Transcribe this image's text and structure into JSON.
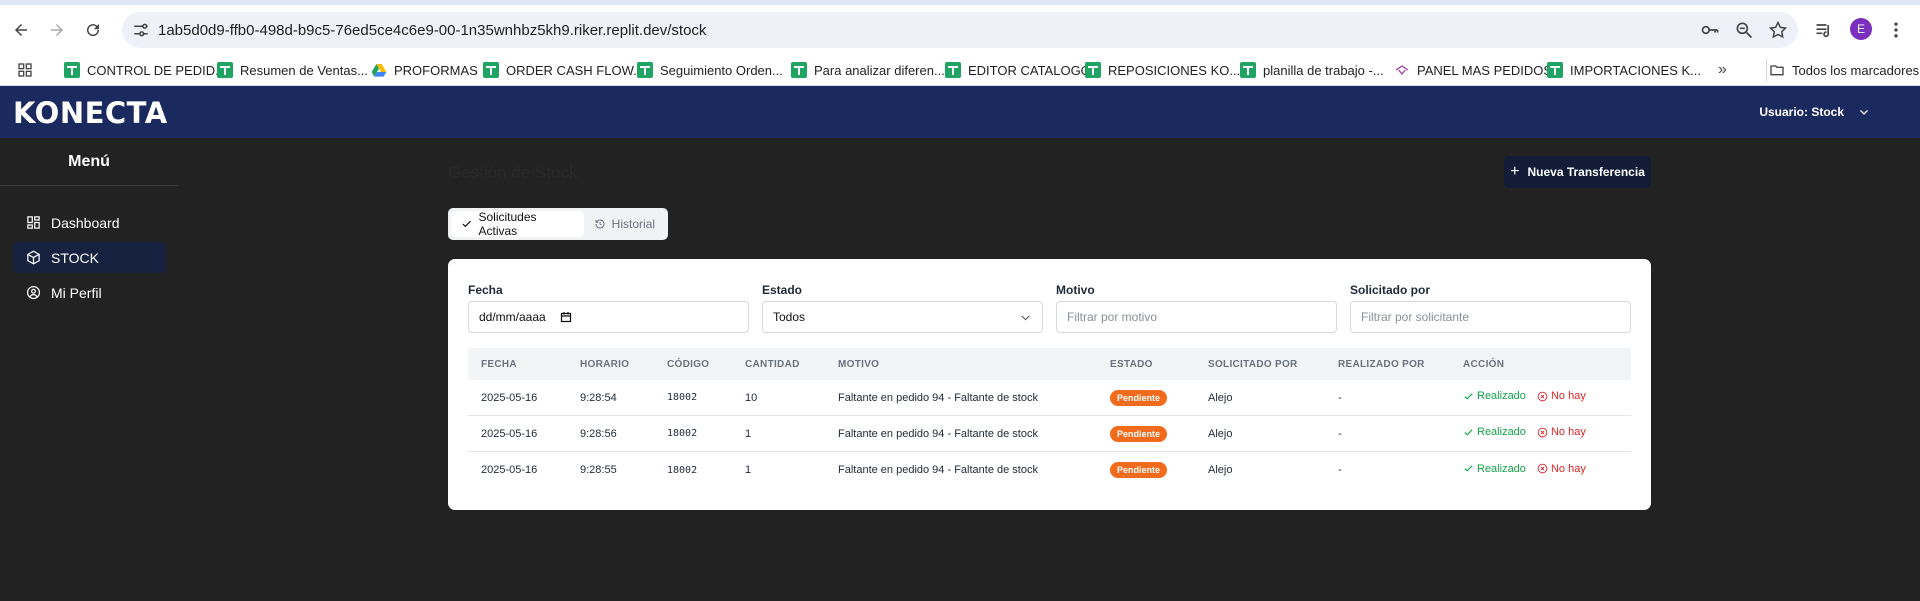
{
  "browser": {
    "url": "1ab5d0d9-ffb0-498d-b9c5-76ed5ce4c6e9-00-1n35wnhbz5kh9.riker.replit.dev/stock",
    "profile_initial": "E",
    "bookmarks": [
      {
        "label": "CONTROL DE PEDID...",
        "icon": "sheets-icon"
      },
      {
        "label": "Resumen de Ventas...",
        "icon": "sheets-icon"
      },
      {
        "label": "PROFORMAS",
        "icon": "drive-icon"
      },
      {
        "label": "ORDER CASH FLOW...",
        "icon": "sheets-icon"
      },
      {
        "label": "Seguimiento Orden...",
        "icon": "sheets-icon"
      },
      {
        "label": "Para analizar diferen...",
        "icon": "sheets-icon"
      },
      {
        "label": "EDITOR CATALOGO",
        "icon": "sheets-icon"
      },
      {
        "label": "REPOSICIONES KO...",
        "icon": "sheets-icon"
      },
      {
        "label": "planilla de trabajo -...",
        "icon": "sheets-icon"
      },
      {
        "label": "PANEL MAS PEDIDOS",
        "icon": "app-icon"
      },
      {
        "label": "IMPORTACIONES K...",
        "icon": "sheets-icon"
      }
    ],
    "all_bookmarks_label": "Todos los marcadores"
  },
  "app": {
    "logo": "KONECTA",
    "user_label": "Usuario: Stock"
  },
  "sidebar": {
    "title": "Menú",
    "items": [
      {
        "label": "Dashboard",
        "icon": "dashboard-icon",
        "active": false
      },
      {
        "label": "STOCK",
        "icon": "box-icon",
        "active": true
      },
      {
        "label": "Mi Perfil",
        "icon": "user-circle-icon",
        "active": false
      }
    ]
  },
  "main": {
    "title": "Gestión de Stock",
    "new_button": "Nueva Transferencia",
    "tabs": [
      {
        "label": "Solicitudes Activas",
        "active": true
      },
      {
        "label": "Historial",
        "active": false
      }
    ],
    "filters": {
      "fecha": {
        "label": "Fecha",
        "value": "dd/mm/aaaa"
      },
      "estado": {
        "label": "Estado",
        "value": "Todos"
      },
      "motivo": {
        "label": "Motivo",
        "placeholder": "Filtrar por motivo"
      },
      "solicitado": {
        "label": "Solicitado por",
        "placeholder": "Filtrar por solicitante"
      }
    },
    "table": {
      "headers": [
        "FECHA",
        "HORARIO",
        "CÓDIGO",
        "CANTIDAD",
        "MOTIVO",
        "ESTADO",
        "SOLICITADO POR",
        "REALIZADO POR",
        "ACCIÓN"
      ],
      "rows": [
        {
          "fecha": "2025-05-16",
          "horario": "9:28:54",
          "codigo": "18002",
          "cantidad": "10",
          "motivo": "Faltante en pedido 94 - Faltante de stock",
          "estado": "Pendiente",
          "solicitado": "Alejo",
          "realizado": "-",
          "accion_done": "Realizado",
          "accion_none": "No hay"
        },
        {
          "fecha": "2025-05-16",
          "horario": "9:28:56",
          "codigo": "18002",
          "cantidad": "1",
          "motivo": "Faltante en pedido 94 - Faltante de stock",
          "estado": "Pendiente",
          "solicitado": "Alejo",
          "realizado": "-",
          "accion_done": "Realizado",
          "accion_none": "No hay"
        },
        {
          "fecha": "2025-05-16",
          "horario": "9:28:55",
          "codigo": "18002",
          "cantidad": "1",
          "motivo": "Faltante en pedido 94 - Faltante de stock",
          "estado": "Pendiente",
          "solicitado": "Alejo",
          "realizado": "-",
          "accion_done": "Realizado",
          "accion_none": "No hay"
        }
      ]
    }
  },
  "colors": {
    "header": "#1b2a5e",
    "badge": "#f26b1d",
    "done": "#16a34a",
    "none": "#dc2626"
  }
}
